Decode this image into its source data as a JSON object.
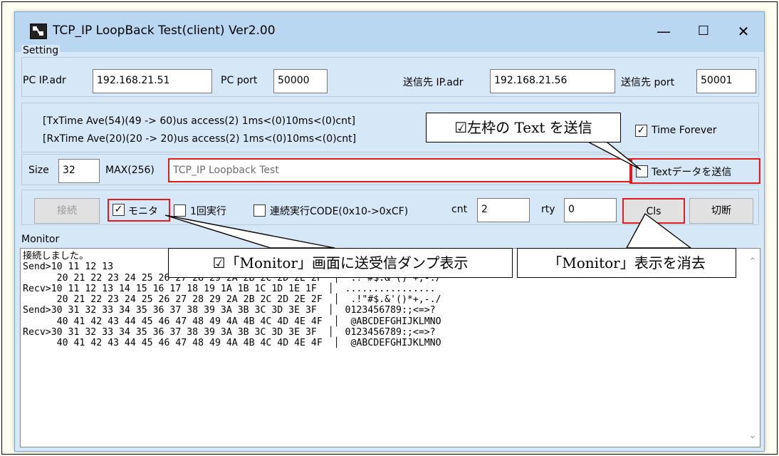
{
  "window": {
    "title": "TCP_IP LoopBack Test(client) Ver2.00",
    "minimize": "—",
    "maximize": "☐",
    "close": "✕"
  },
  "setting": {
    "group_label": "Setting",
    "pc_ip_label": "PC IP.adr",
    "pc_ip_value": "192.168.21.51",
    "pc_port_label": "PC port",
    "pc_port_value": "50000",
    "dest_ip_label": "送信先 IP.adr",
    "dest_ip_value": "192.168.21.56",
    "dest_port_label": "送信先 port",
    "dest_port_value": "50001"
  },
  "timing": {
    "tx_line": "[TxTime Ave(54)(49 -> 60)us access(2) 1ms<(0)10ms<(0)cnt]",
    "rx_line": "[RxTime Ave(20)(20 -> 20)us access(2) 1ms<(0)10ms<(0)cnt]",
    "time_forever_label": "Time Forever",
    "time_forever_checked": true
  },
  "payload": {
    "size_label": "Size",
    "size_value": "32",
    "max_label": "MAX(256)",
    "text_value": "TCP_IP Loopback Test",
    "send_text_label": "Textデータを送信",
    "send_text_checked": false
  },
  "controls": {
    "connect_label": "接続",
    "monitor_label": "モニタ",
    "monitor_checked": true,
    "once_label": "1回実行",
    "once_checked": false,
    "continuous_label": "連続実行CODE(0x10->0xCF)",
    "continuous_checked": false,
    "cnt_label": "cnt",
    "cnt_value": "2",
    "rty_label": "rty",
    "rty_value": "0",
    "cls_label": "Cls",
    "disconnect_label": "切断"
  },
  "monitor": {
    "group_label": "Monitor",
    "lines": [
      "接続しました。",
      "Send>10 11 12 13",
      "      20 21 22 23 24 25 26 27 28 29 2A 2B 2C 2D 2E 2F  │  .!\"#$.&'()*+,-./",
      "Recv>10 11 12 13 14 15 16 17 18 19 1A 1B 1C 1D 1E 1F  │  ................",
      "      20 21 22 23 24 25 26 27 28 29 2A 2B 2C 2D 2E 2F  │  .!\"#$.&'()*+,-./",
      "Send>30 31 32 33 34 35 36 37 38 39 3A 3B 3C 3D 3E 3F  │  0123456789:;<=>?",
      "      40 41 42 43 44 45 46 47 48 49 4A 4B 4C 4D 4E 4F  │  @ABCDEFGHIJKLMNO",
      "Recv>30 31 32 33 34 35 36 37 38 39 3A 3B 3C 3D 3E 3F  │  0123456789:;<=>?",
      "      40 41 42 43 44 45 46 47 48 49 4A 4B 4C 4D 4E 4F  │  @ABCDEFGHIJKLMNO"
    ]
  },
  "callouts": {
    "send_text": "☑左枠の Text を送信",
    "monitor_dump": "☑「Monitor」画面に送受信ダンプ表示",
    "cls": "「Monitor」表示を消去"
  },
  "icons": {
    "app": "app-icon",
    "check": "✓",
    "scroll_up": "⌃",
    "scroll_down": "⌄"
  }
}
